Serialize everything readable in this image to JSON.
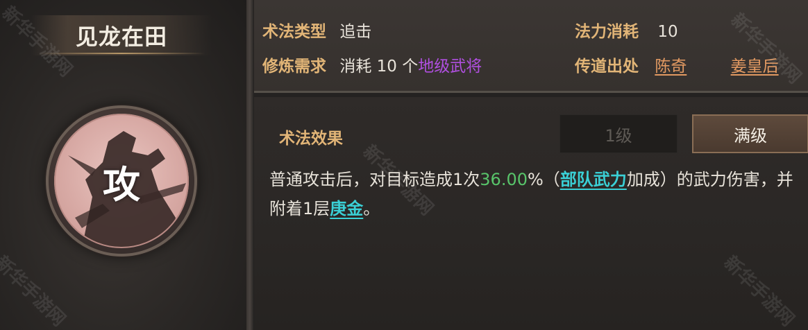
{
  "skill": {
    "name": "见龙在田",
    "type_glyph": "攻"
  },
  "info": {
    "type_label": "术法类型",
    "type_value": "追击",
    "cost_label": "法力消耗",
    "cost_value": "10",
    "training_label": "修炼需求",
    "training_prefix": "消耗 10 个",
    "training_item": "地级武将",
    "source_label": "传道出处",
    "sources": [
      "陈奇",
      "姜皇后"
    ]
  },
  "effect": {
    "title": "术法效果",
    "levels": [
      "1级",
      "满级"
    ],
    "selected_level": "满级",
    "text_1": "普通攻击后，对目标造成1次",
    "percent": "36.00",
    "text_2": "%（",
    "attr_link": "部队武力",
    "text_3": "加成）的武力伤害，并附着1层",
    "status_link": "庚金",
    "text_4": "。"
  },
  "watermark": "新华手游网",
  "colors": {
    "label_gold": "#e2b577",
    "purple": "#b04fe0",
    "green": "#58c46a",
    "cyan": "#3ad0d6",
    "orange_link": "#e39a62"
  }
}
